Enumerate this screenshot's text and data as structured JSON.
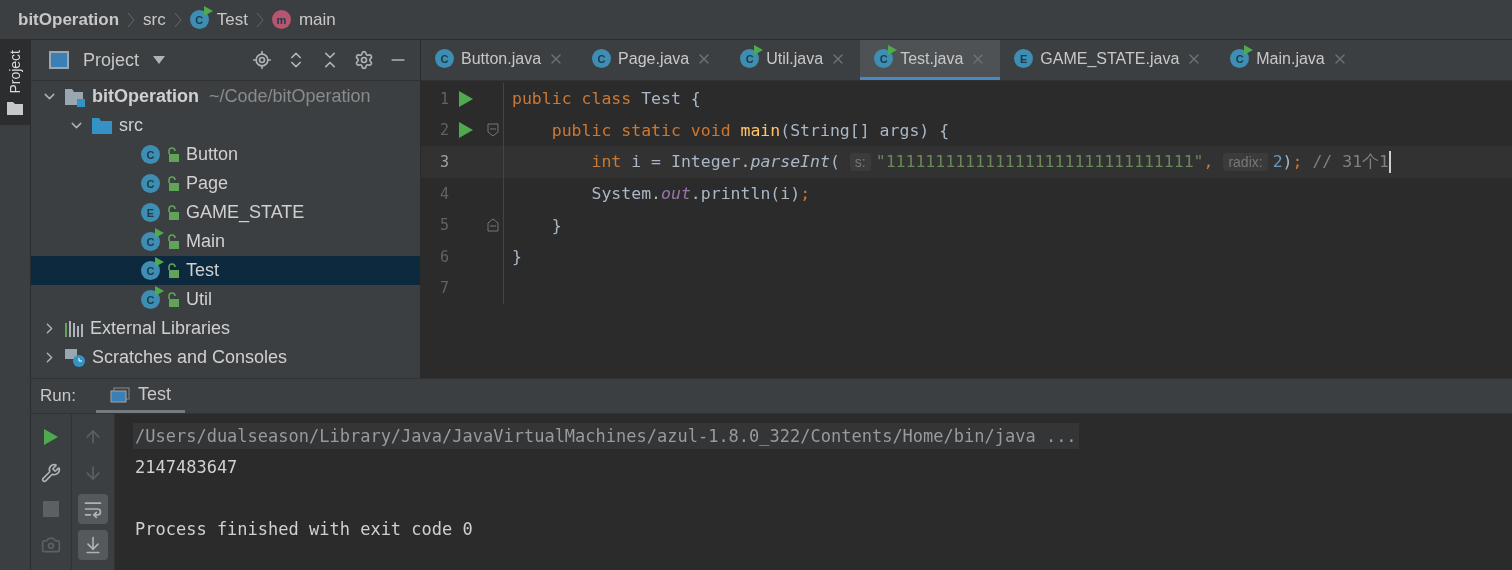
{
  "breadcrumb": [
    {
      "label": "bitOperation",
      "kind": "plain"
    },
    {
      "label": "src",
      "kind": "plain"
    },
    {
      "label": "Test",
      "kind": "class",
      "icon_letter": "C",
      "runnable": true
    },
    {
      "label": "main",
      "kind": "method",
      "icon_letter": "m"
    }
  ],
  "tool_stripe": [
    {
      "label": "Project",
      "selected": true
    }
  ],
  "project": {
    "title": "Project",
    "tree": [
      {
        "label": "bitOperation",
        "path": "~/Code/bitOperation",
        "kind": "module",
        "expanded": true,
        "selected": false,
        "children": [
          {
            "label": "src",
            "kind": "folder",
            "expanded": true,
            "selected": false,
            "children": [
              {
                "label": "Button",
                "kind": "class",
                "icon_letter": "C",
                "runnable": false,
                "selected": false
              },
              {
                "label": "Page",
                "kind": "class",
                "icon_letter": "C",
                "runnable": false,
                "selected": false
              },
              {
                "label": "GAME_STATE",
                "kind": "class",
                "icon_letter": "E",
                "runnable": false,
                "selected": false
              },
              {
                "label": "Main",
                "kind": "class",
                "icon_letter": "C",
                "runnable": true,
                "selected": false
              },
              {
                "label": "Test",
                "kind": "class",
                "icon_letter": "C",
                "runnable": true,
                "selected": true
              },
              {
                "label": "Util",
                "kind": "class",
                "icon_letter": "C",
                "runnable": true,
                "selected": false
              }
            ]
          }
        ]
      },
      {
        "label": "External Libraries",
        "kind": "libraries",
        "expanded": false,
        "selected": false
      },
      {
        "label": "Scratches and Consoles",
        "kind": "scratches",
        "expanded": false,
        "selected": false
      }
    ]
  },
  "tabs": [
    {
      "label": "Button.java",
      "icon_letter": "C",
      "runnable": false,
      "selected": false
    },
    {
      "label": "Page.java",
      "icon_letter": "C",
      "runnable": false,
      "selected": false
    },
    {
      "label": "Util.java",
      "icon_letter": "C",
      "runnable": true,
      "selected": false
    },
    {
      "label": "Test.java",
      "icon_letter": "C",
      "runnable": true,
      "selected": true
    },
    {
      "label": "GAME_STATE.java",
      "icon_letter": "E",
      "runnable": false,
      "selected": false
    },
    {
      "label": "Main.java",
      "icon_letter": "C",
      "runnable": true,
      "selected": false
    }
  ],
  "code": [
    {
      "number": "1",
      "run": true,
      "fold_start": false,
      "fold_end": false,
      "current": false,
      "tokens": [
        {
          "kind": "keyword",
          "text": "public class "
        },
        {
          "kind": "plain",
          "text": "Test {"
        }
      ]
    },
    {
      "number": "2",
      "run": true,
      "fold_start": true,
      "fold_end": false,
      "current": false,
      "tokens": [
        {
          "kind": "keyword",
          "text": "    public static void "
        },
        {
          "kind": "method",
          "text": "main"
        },
        {
          "kind": "plain",
          "text": "(String[] args) {"
        }
      ]
    },
    {
      "number": "3",
      "run": false,
      "fold_start": false,
      "fold_end": false,
      "current": true,
      "tokens": [
        {
          "kind": "keyword",
          "text": "        int "
        },
        {
          "kind": "plain",
          "text": "i = Integer."
        },
        {
          "kind": "call",
          "text": "parseInt"
        },
        {
          "kind": "plain",
          "text": "( "
        },
        {
          "kind": "hint",
          "text": "s:"
        },
        {
          "kind": "string",
          "text": "\"1111111111111111111111111111111\""
        },
        {
          "kind": "keyword",
          "text": ", "
        },
        {
          "kind": "hint",
          "text": "radix:"
        },
        {
          "kind": "number",
          "text": "2"
        },
        {
          "kind": "plain",
          "text": ")"
        },
        {
          "kind": "keyword",
          "text": "; "
        },
        {
          "kind": "comment",
          "text": "// 31个1"
        }
      ]
    },
    {
      "number": "4",
      "run": false,
      "fold_start": false,
      "fold_end": false,
      "current": false,
      "tokens": [
        {
          "kind": "plain",
          "text": "        System."
        },
        {
          "kind": "field",
          "text": "out"
        },
        {
          "kind": "plain",
          "text": ".println(i)"
        },
        {
          "kind": "keyword",
          "text": ";"
        }
      ]
    },
    {
      "number": "5",
      "run": false,
      "fold_start": false,
      "fold_end": true,
      "current": false,
      "tokens": [
        {
          "kind": "plain",
          "text": "    }"
        }
      ]
    },
    {
      "number": "6",
      "run": false,
      "fold_start": false,
      "fold_end": false,
      "current": false,
      "tokens": [
        {
          "kind": "plain",
          "text": "}"
        }
      ]
    },
    {
      "number": "7",
      "run": false,
      "fold_start": false,
      "fold_end": false,
      "current": false
    }
  ],
  "run": {
    "title": "Run:",
    "tabs": [
      {
        "label": "Test",
        "selected": true
      }
    ],
    "toolbar": [
      {
        "kind": "rerun",
        "disabled": false
      },
      {
        "kind": "settings",
        "disabled": false
      },
      {
        "kind": "stop",
        "disabled": true
      },
      {
        "kind": "screenshot",
        "disabled": true
      }
    ],
    "toolbar2": [
      {
        "kind": "up",
        "on": false,
        "disabled": true
      },
      {
        "kind": "down",
        "on": false,
        "disabled": true
      },
      {
        "kind": "wrap",
        "on": true,
        "disabled": false
      },
      {
        "kind": "scroll-end",
        "on": true,
        "disabled": false
      }
    ],
    "console": [
      {
        "kind": "command",
        "text": "/Users/dualseason/Library/Java/JavaVirtualMachines/azul-1.8.0_322/Contents/Home/bin/java ..."
      },
      {
        "kind": "output",
        "text": "2147483647"
      },
      {
        "kind": "status",
        "text": "Process finished with exit code 0"
      }
    ]
  }
}
